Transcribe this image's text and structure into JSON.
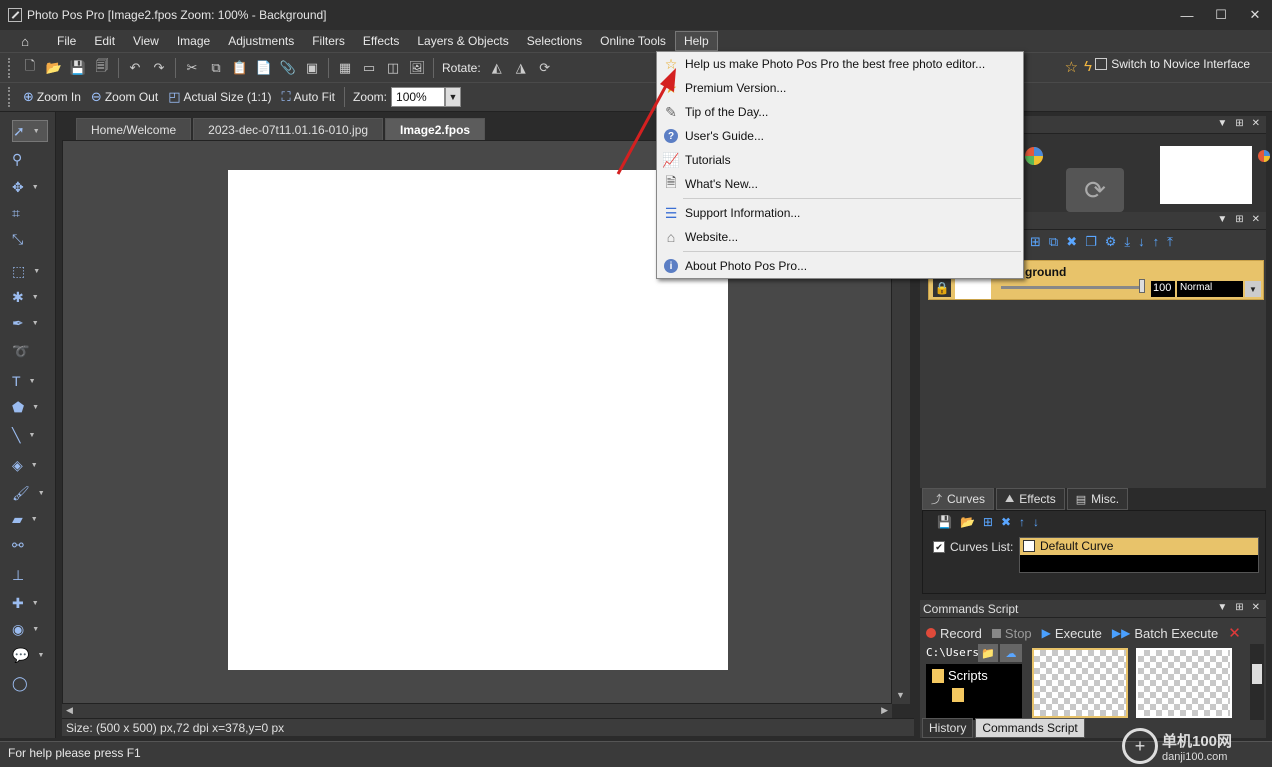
{
  "window": {
    "title": "Photo Pos Pro [Image2.fpos Zoom: 100% - Background]",
    "controls": [
      "—",
      "☐",
      "✕"
    ]
  },
  "menubar": {
    "items": [
      "File",
      "Edit",
      "View",
      "Image",
      "Adjustments",
      "Filters",
      "Effects",
      "Layers & Objects",
      "Selections",
      "Online Tools",
      "Help"
    ],
    "active": "Help"
  },
  "toolbar1": {
    "rotate_label": "Rotate:",
    "novice_label": "Switch to Novice Interface"
  },
  "toolbar2": {
    "zoom_in": "Zoom In",
    "zoom_out": "Zoom Out",
    "actual_size": "Actual Size (1:1)",
    "auto_fit": "Auto Fit",
    "zoom_label": "Zoom:",
    "zoom_value": "100%"
  },
  "doc_tabs": [
    "Home/Welcome",
    "2023-dec-07t11.01.16-010.jpg",
    "Image2.fpos"
  ],
  "doc_tab_active": "Image2.fpos",
  "canvas": {
    "size_info": "Size: (500 x 500) px,72 dpi   x=378,y=0 px"
  },
  "statusbar": {
    "text": "For help please press F1"
  },
  "help_menu": {
    "items": [
      {
        "label": "Help us make Photo Pos Pro the best free photo editor...",
        "icon": "star-icon"
      },
      {
        "label": "Premium Version...",
        "icon": "star-icon"
      },
      {
        "label": "Tip of the Day...",
        "icon": "pencil-icon"
      },
      {
        "label": "User's Guide...",
        "icon": "question-icon"
      },
      {
        "label": "Tutorials",
        "icon": "chart-icon"
      },
      {
        "label": "What's New...",
        "icon": "page-icon"
      },
      {
        "label": "Support  Information...",
        "icon": "list-icon"
      },
      {
        "label": "Website...",
        "icon": "home-icon"
      },
      {
        "label": "About Photo Pos Pro...",
        "icon": "info-icon"
      }
    ]
  },
  "layers": {
    "layer_name": "ground",
    "opacity": "100",
    "blend_mode": "Normal"
  },
  "panel_tabs": [
    "Curves",
    "Effects",
    "Misc."
  ],
  "panel_tab_active": "Curves",
  "curves": {
    "list_label": "Curves List:",
    "items": [
      "Default Curve"
    ]
  },
  "commands_script": {
    "title": "Commands Script",
    "record": "Record",
    "stop": "Stop",
    "execute": "Execute",
    "batch_execute": "Batch Execute",
    "path": "C:\\Users",
    "tree_root": "Scripts"
  },
  "bottom_tabs": [
    "History",
    "Commands Script"
  ],
  "bottom_tab_active": "Commands Script",
  "watermark": {
    "cn": "单机100网",
    "url": "danji100.com"
  },
  "colors": {
    "accent_gold": "#e8c36a",
    "arrow_red": "#d42020",
    "icon_blue": "#5aa6ff"
  }
}
